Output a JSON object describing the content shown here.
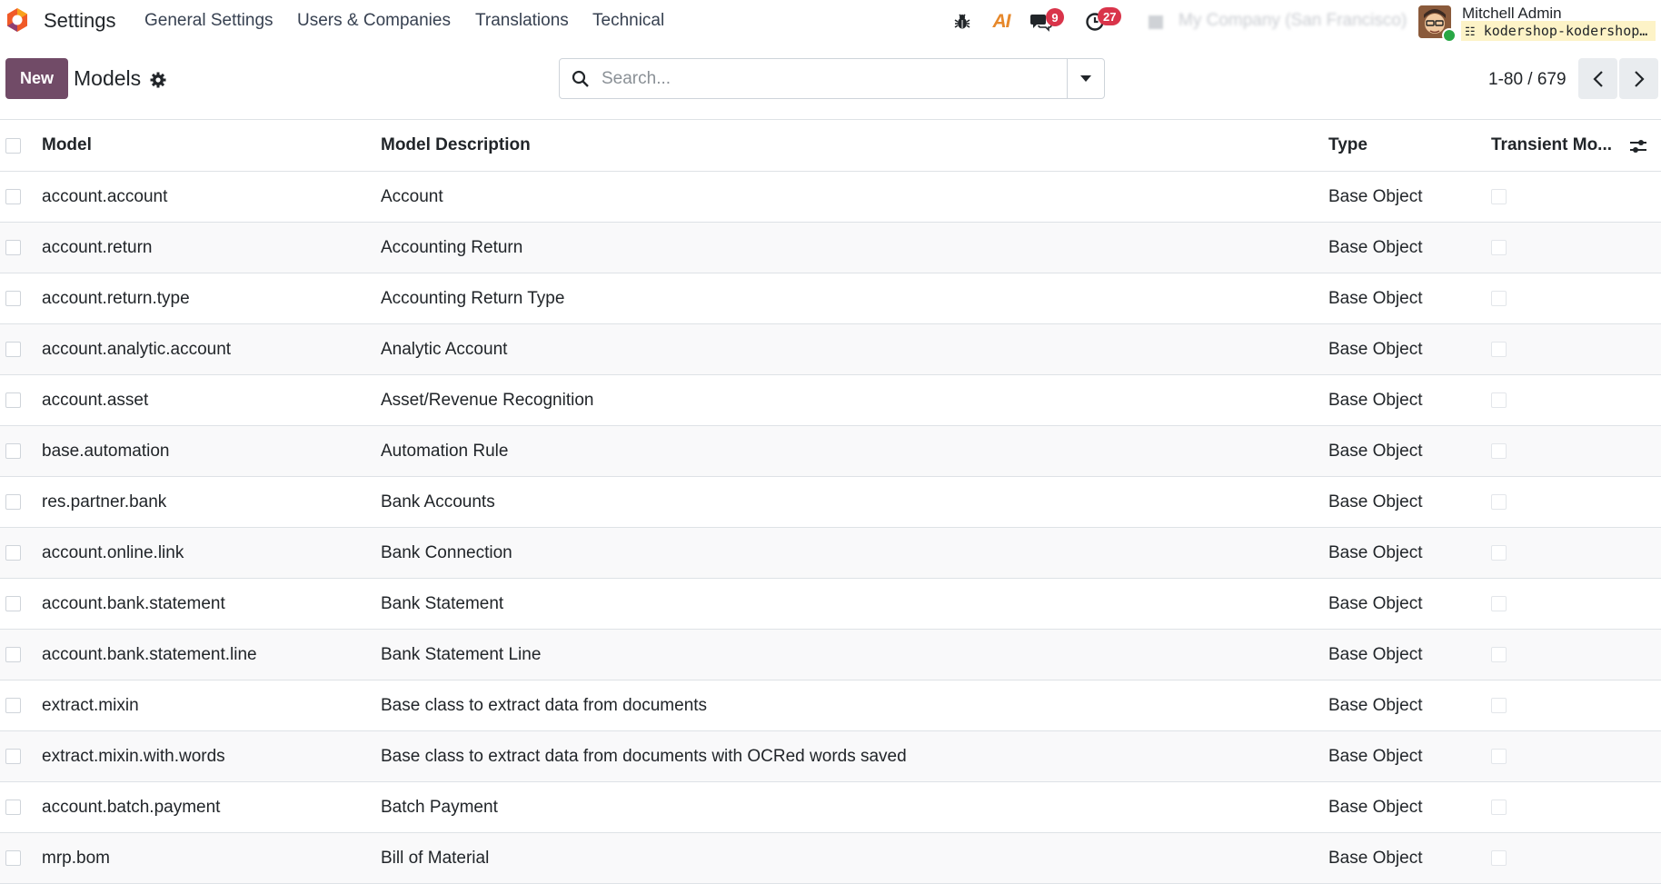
{
  "app": {
    "name": "Settings",
    "menu": [
      "General Settings",
      "Users & Companies",
      "Translations",
      "Technical"
    ]
  },
  "systray": {
    "debug_icon": "bug-icon",
    "ai_label": "AI",
    "messages_count": "9",
    "activities_count": "27",
    "company_switch": "My Company (San Francisco)",
    "user_name": "Mitchell Admin",
    "database": "kodershop-kodershop-staging"
  },
  "control_panel": {
    "new_label": "New",
    "title": "Models",
    "search_placeholder": "Search...",
    "pager": "1-80 / 679"
  },
  "table": {
    "columns": [
      "Model",
      "Model Description",
      "Type",
      "Transient Mo..."
    ],
    "rows": [
      {
        "model": "account.account",
        "description": "Account",
        "type": "Base Object",
        "transient": false
      },
      {
        "model": "account.return",
        "description": "Accounting Return",
        "type": "Base Object",
        "transient": false
      },
      {
        "model": "account.return.type",
        "description": "Accounting Return Type",
        "type": "Base Object",
        "transient": false
      },
      {
        "model": "account.analytic.account",
        "description": "Analytic Account",
        "type": "Base Object",
        "transient": false
      },
      {
        "model": "account.asset",
        "description": "Asset/Revenue Recognition",
        "type": "Base Object",
        "transient": false
      },
      {
        "model": "base.automation",
        "description": "Automation Rule",
        "type": "Base Object",
        "transient": false
      },
      {
        "model": "res.partner.bank",
        "description": "Bank Accounts",
        "type": "Base Object",
        "transient": false
      },
      {
        "model": "account.online.link",
        "description": "Bank Connection",
        "type": "Base Object",
        "transient": false
      },
      {
        "model": "account.bank.statement",
        "description": "Bank Statement",
        "type": "Base Object",
        "transient": false
      },
      {
        "model": "account.bank.statement.line",
        "description": "Bank Statement Line",
        "type": "Base Object",
        "transient": false
      },
      {
        "model": "extract.mixin",
        "description": "Base class to extract data from documents",
        "type": "Base Object",
        "transient": false
      },
      {
        "model": "extract.mixin.with.words",
        "description": "Base class to extract data from documents with OCRed words saved",
        "type": "Base Object",
        "transient": false
      },
      {
        "model": "account.batch.payment",
        "description": "Batch Payment",
        "type": "Base Object",
        "transient": false
      },
      {
        "model": "mrp.bom",
        "description": "Bill of Material",
        "type": "Base Object",
        "transient": false
      }
    ]
  },
  "colors": {
    "primary": "#714b67",
    "badge": "#d9344a",
    "row_alt": "#f9f9fa",
    "border": "#dee2e6"
  }
}
